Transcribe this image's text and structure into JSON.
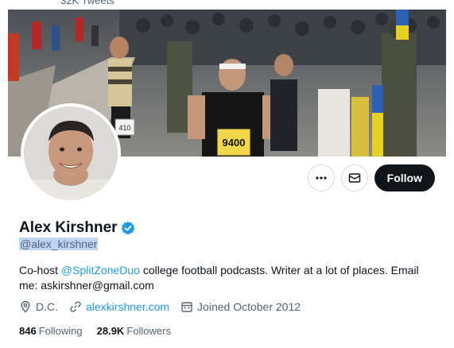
{
  "header": {
    "tweet_count": "32K Tweets"
  },
  "profile": {
    "display_name": "Alex Kirshner",
    "handle": "@alex_kirshner",
    "bio": {
      "prefix": "Co-host ",
      "mention": "@SplitZoneDuo",
      "suffix": " college football podcasts. Writer at a lot of places. Email me: askirshner@gmail.com"
    },
    "location": "D.C.",
    "website": "alexkirshner.com",
    "joined": "Joined October 2012",
    "following_count": "846",
    "following_label": "Following",
    "followers_count": "28.9K",
    "followers_label": "Followers"
  },
  "actions": {
    "follow_label": "Follow"
  },
  "banner": {
    "bib_number": "9400",
    "bib_small": "410"
  },
  "icons": {
    "more": "more-dots-icon",
    "message": "envelope-icon",
    "verified": "verified-badge-icon",
    "location": "location-pin-icon",
    "link": "link-icon",
    "calendar": "calendar-icon"
  },
  "colors": {
    "accent": "#1d9bf0",
    "text": "#0f1419",
    "muted": "#536471",
    "follow_bg": "#0f1419"
  }
}
